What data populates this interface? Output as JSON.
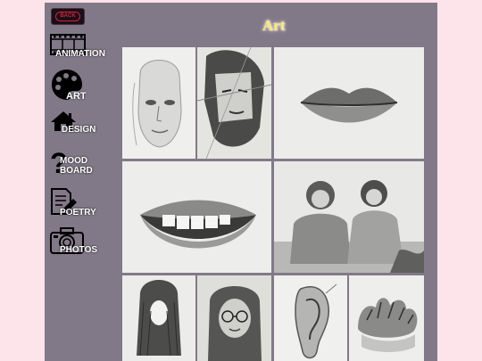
{
  "header": {
    "title": "Art"
  },
  "back_button": {
    "label": "BACK"
  },
  "nav": {
    "animation": "ANIMATION",
    "art": "ART",
    "design": "DESIGN",
    "mood_line1": "MOOD",
    "mood_line2": "BOARD",
    "poetry": "POETRY",
    "photos": "PHOTOS"
  },
  "colors": {
    "page_background": "#fde3ea",
    "panel": "#827988",
    "title": "#fbe77c",
    "back_accent": "#d4213a"
  },
  "gallery": [
    "pencil-sketch-face",
    "pencil-sketch-face-collage",
    "pencil-sketch-lips",
    "pencil-sketch-smiling-mouth",
    "pencil-sketch-two-girls",
    "pencil-sketch-hair",
    "pencil-sketch-girl-glasses",
    "pencil-sketch-ear",
    "pencil-sketch-hair-texture"
  ]
}
